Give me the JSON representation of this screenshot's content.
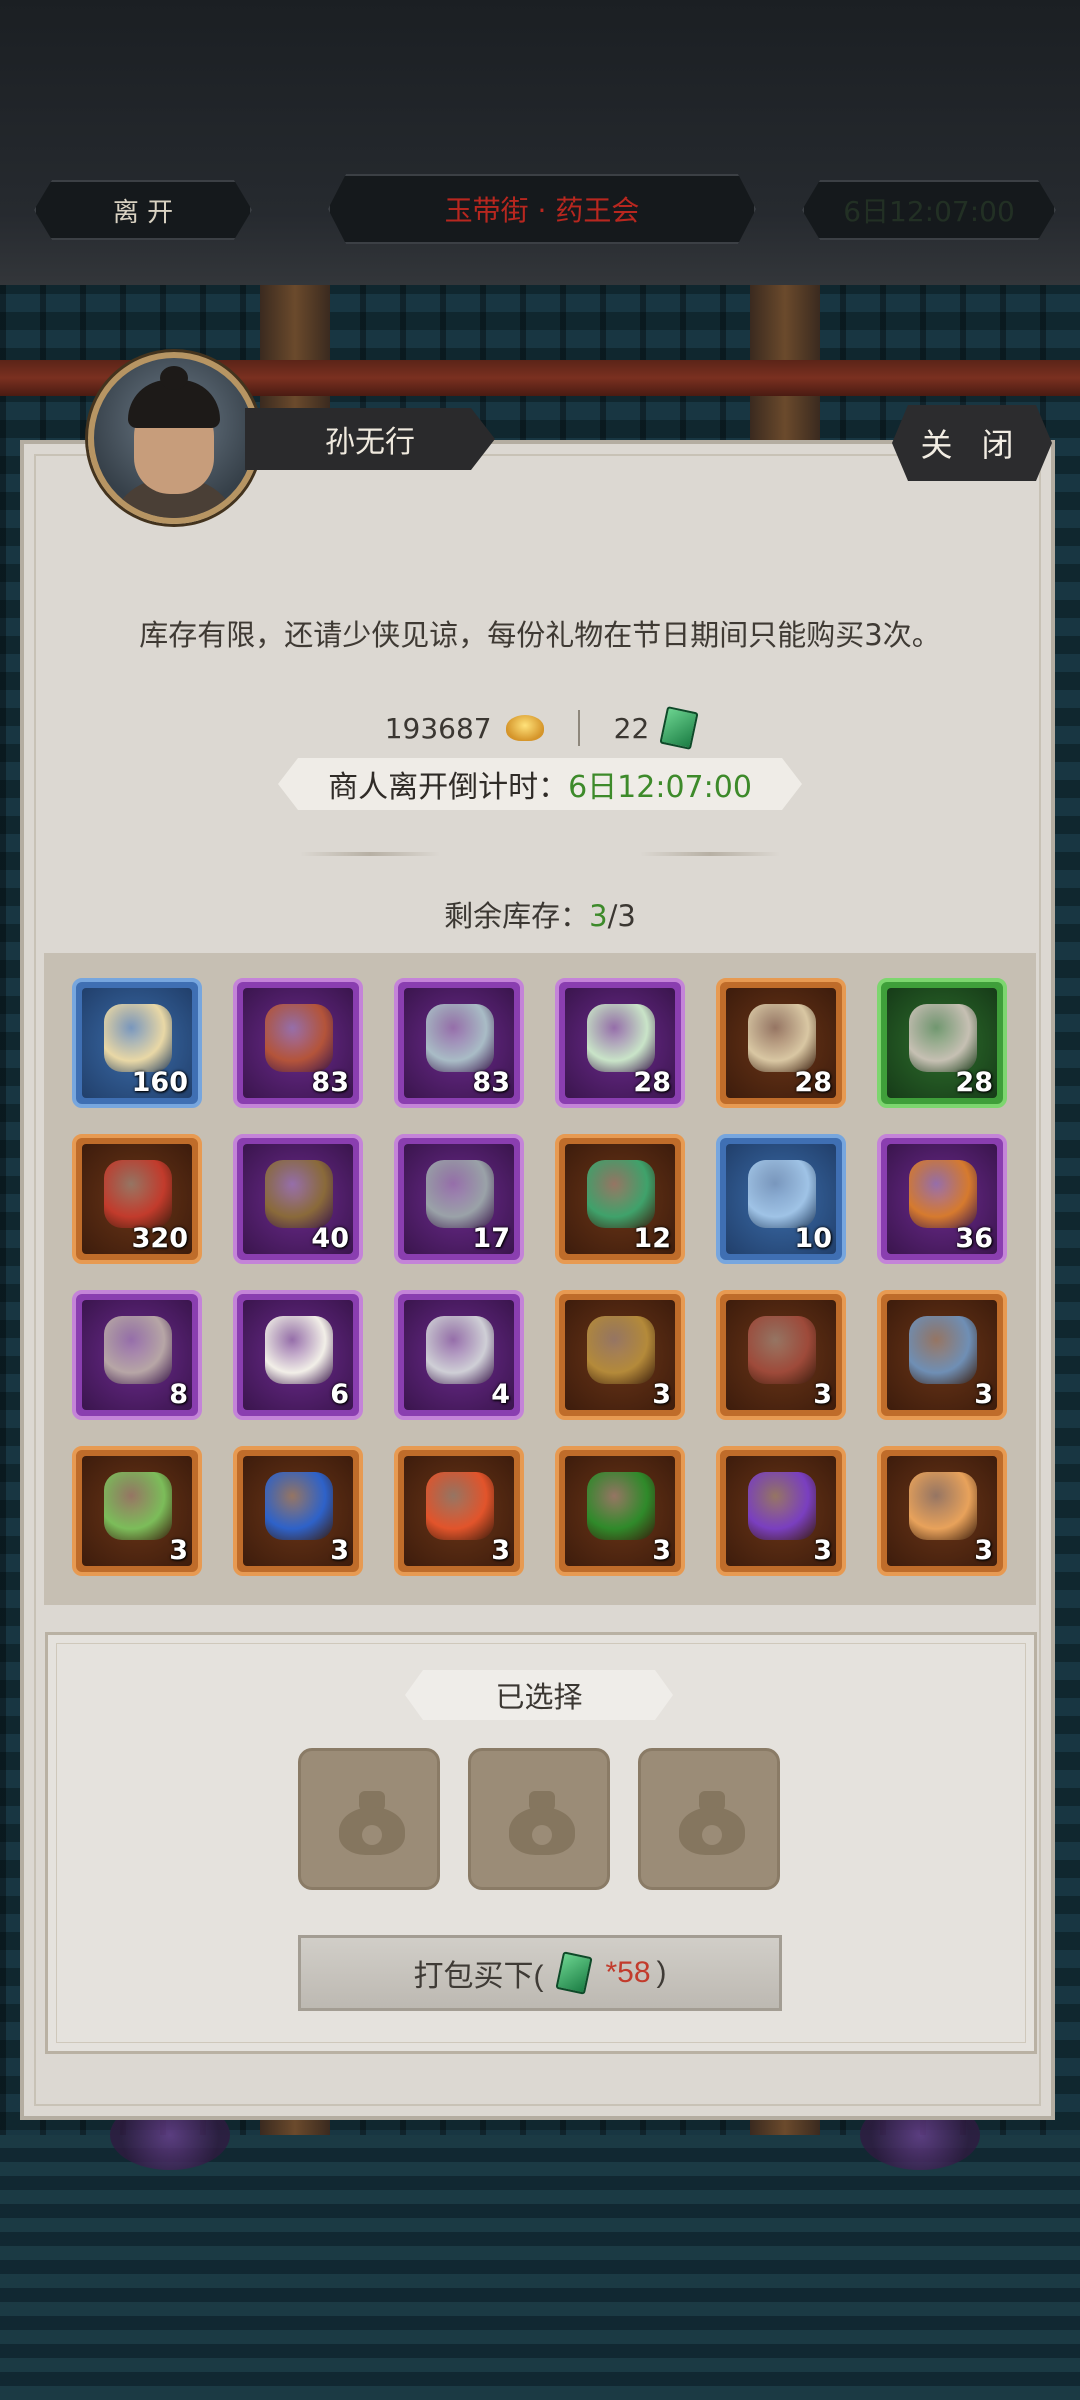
{
  "topbar": {
    "leave_label": "离 开",
    "location_title": "玉带街 · 药王会",
    "timer": "6日12:07:00"
  },
  "merchant": {
    "name": "孙无行",
    "close_label": "关 闭",
    "notice": "库存有限，还请少侠见谅，每份礼物在节日期间只能购买3次。"
  },
  "currency": {
    "gold": "193687",
    "jade": "22"
  },
  "countdown": {
    "label": "商人离开倒计时：",
    "value": "6日12:07:00"
  },
  "stock": {
    "label": "剩余库存：",
    "current": "3",
    "total": "/3"
  },
  "items": [
    {
      "count": "160",
      "quality": "blue",
      "icon": "manual-scroll-icon",
      "art": "#e9d8a6"
    },
    {
      "count": "83",
      "quality": "purple",
      "icon": "red-ore-icon",
      "art": "#b4543a"
    },
    {
      "count": "83",
      "quality": "purple",
      "icon": "crystal-shard-icon",
      "art": "#a9bcc6"
    },
    {
      "count": "28",
      "quality": "purple",
      "icon": "jade-leaf-icon",
      "art": "#c9e4c8"
    },
    {
      "count": "28",
      "quality": "orange",
      "icon": "book-stack-icon",
      "art": "#d9c7a3"
    },
    {
      "count": "28",
      "quality": "green",
      "icon": "stone-disc-icon",
      "art": "#c6c0b3"
    },
    {
      "count": "320",
      "quality": "orange",
      "icon": "talisman-icon",
      "art": "#c23b2c"
    },
    {
      "count": "40",
      "quality": "purple",
      "icon": "incense-burner-icon",
      "art": "#8a6a3a"
    },
    {
      "count": "17",
      "quality": "purple",
      "icon": "metal-sphere-icon",
      "art": "#9aa2a8"
    },
    {
      "count": "12",
      "quality": "orange",
      "icon": "green-scroll-icon",
      "art": "#3fa26b"
    },
    {
      "count": "10",
      "quality": "blue",
      "icon": "crystal-orb-icon",
      "art": "#9fc3e6"
    },
    {
      "count": "36",
      "quality": "purple",
      "icon": "pearls-icon",
      "art": "#d67a2e"
    },
    {
      "count": "8",
      "quality": "purple",
      "icon": "dark-crystal-icon",
      "art": "#b7a6a6"
    },
    {
      "count": "6",
      "quality": "purple",
      "icon": "pearl-icon",
      "art": "#f2efe8"
    },
    {
      "count": "4",
      "quality": "purple",
      "icon": "silver-shards-icon",
      "art": "#cfcfd6"
    },
    {
      "count": "3",
      "quality": "orange",
      "icon": "gold-ore-icon",
      "art": "#b48a3a"
    },
    {
      "count": "3",
      "quality": "orange",
      "icon": "red-ore-rock-icon",
      "art": "#9e4a3a"
    },
    {
      "count": "3",
      "quality": "orange",
      "icon": "blue-ore-icon",
      "art": "#6f8fb5"
    },
    {
      "count": "3",
      "quality": "orange",
      "icon": "green-ore-icon",
      "art": "#7cbd5a"
    },
    {
      "count": "3",
      "quality": "orange",
      "icon": "sapphire-icon",
      "art": "#2e62c9"
    },
    {
      "count": "3",
      "quality": "orange",
      "icon": "fire-gem-icon",
      "art": "#e2542b"
    },
    {
      "count": "3",
      "quality": "orange",
      "icon": "emerald-icon",
      "art": "#2f8a2a"
    },
    {
      "count": "3",
      "quality": "orange",
      "icon": "amethyst-icon",
      "art": "#7a3fc0"
    },
    {
      "count": "3",
      "quality": "orange",
      "icon": "amber-orb-icon",
      "art": "#e8a25b"
    }
  ],
  "selection": {
    "title": "已选择",
    "slots": [
      "empty-bag-icon",
      "empty-bag-icon",
      "empty-bag-icon"
    ],
    "buy_prefix": "打包买下(",
    "buy_price": "*58",
    "buy_suffix": ")"
  },
  "colors": {
    "panel_bg": "#dcd8d2",
    "green_text": "#3d8a2a",
    "red_text": "#c23b2c",
    "quality_blue": "#77a6de",
    "quality_purple": "#c484d8",
    "quality_orange": "#e79a52",
    "quality_green": "#7dd66f"
  }
}
